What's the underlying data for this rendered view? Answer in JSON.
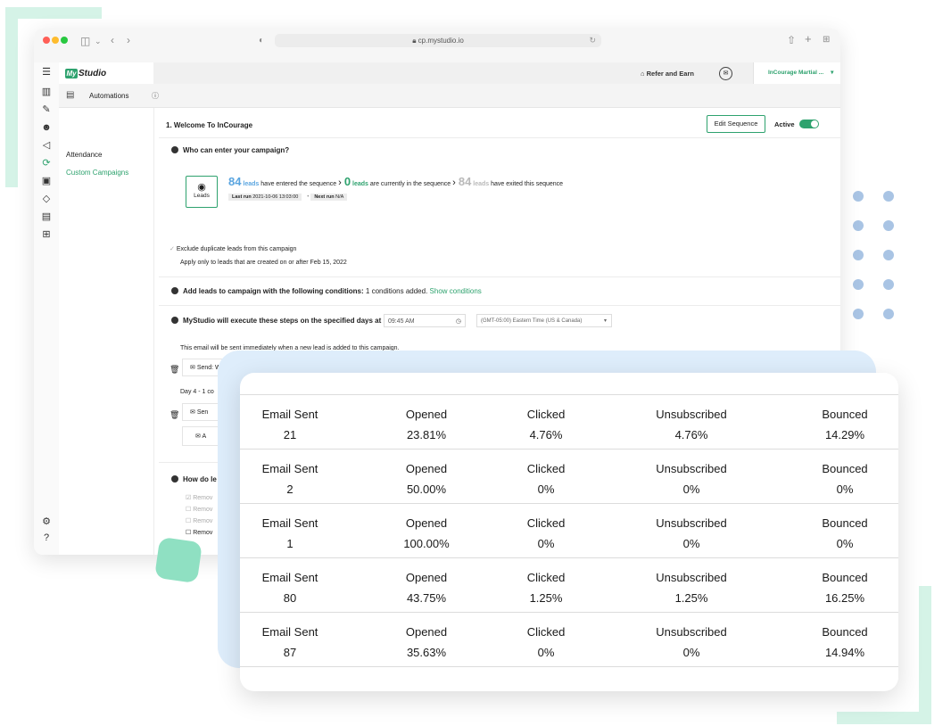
{
  "browser": {
    "url": "cp.mystudio.io"
  },
  "app": {
    "logo_prefix": "My",
    "logo_text": "Studio",
    "refer_label": "Refer and Earn",
    "org_name": "InCourage Martial ...",
    "section_title": "Automations"
  },
  "sidebar": {
    "items": [
      "Attendance",
      "Custom Campaigns"
    ]
  },
  "campaign": {
    "title": "1. Welcome To InCourage",
    "edit_label": "Edit Sequence",
    "active_label": "Active",
    "q1": "Who can enter your campaign?",
    "leads_label": "Leads",
    "entered_count": "84",
    "entered_text": "leads",
    "entered_suffix": "have entered the sequence",
    "current_count": "0",
    "current_text": "leads",
    "current_suffix": "are currently in the sequence",
    "exited_count": "84",
    "exited_text": "leads",
    "exited_suffix": "have exited this sequence",
    "last_run_label": "Last run",
    "last_run_value": "2021-10-06 13:03:00",
    "next_run_label": "Next run",
    "next_run_value": "N/A",
    "exclude_text": "Exclude duplicate leads from this campaign",
    "apply_text": "Apply only to leads that are created on or after Feb 15, 2022",
    "q2": "Add leads to campaign with the following conditions:",
    "q2_count": "1 conditions added.",
    "q2_link": "Show conditions",
    "q3": "MyStudio will execute these steps on the specified days at",
    "time_value": "09:45 AM",
    "timezone": "(GMT-05:00) Eastern Time (US & Canada)",
    "email_note": "This email will be sent immediately when a new lead is added to this campaign.",
    "send_label": "Send: Welcome To InCourage",
    "day_label": "Day 4 - 1 co",
    "send2_label": "Sen",
    "add_label": "A",
    "q4": "How do le",
    "remove_opts": [
      "Remov",
      "Remov",
      "Remov",
      "Remov"
    ]
  },
  "stats": {
    "headers": [
      "Email Sent",
      "Opened",
      "Clicked",
      "Unsubscribed",
      "Bounced"
    ],
    "rows": [
      [
        "21",
        "23.81%",
        "4.76%",
        "4.76%",
        "14.29%"
      ],
      [
        "2",
        "50.00%",
        "0%",
        "0%",
        "0%"
      ],
      [
        "1",
        "100.00%",
        "0%",
        "0%",
        "0%"
      ],
      [
        "80",
        "43.75%",
        "1.25%",
        "1.25%",
        "16.25%"
      ],
      [
        "87",
        "35.63%",
        "0%",
        "0%",
        "14.94%"
      ]
    ]
  },
  "colors": {
    "accent": "#2ea26e",
    "lead_blue": "#5aa5e0",
    "deco_green": "#d5f3e7",
    "stats_bg": "#deedfb",
    "dot": "#a9c4e4"
  }
}
